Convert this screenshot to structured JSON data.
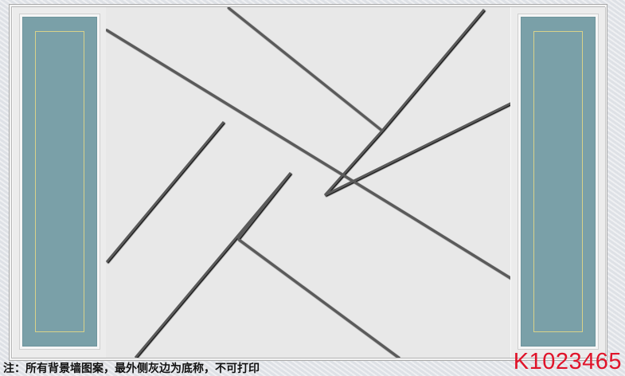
{
  "caption": {
    "note": "注：所有背景墙图案，最外侧灰边为底称，不可打印",
    "code": "K1023465"
  },
  "colors": {
    "panel_teal": "#7aa0a8",
    "panel_line_gold": "#d8d28a",
    "groove_dark": "#5a5a5a",
    "field_light_gray": "#e8e8e8",
    "code_red": "#e0142a"
  },
  "decor": {
    "left_panel_icon": "teal-framed-panel",
    "right_panel_icon": "teal-framed-panel",
    "center_pattern": "diagonal-groove-lines"
  }
}
